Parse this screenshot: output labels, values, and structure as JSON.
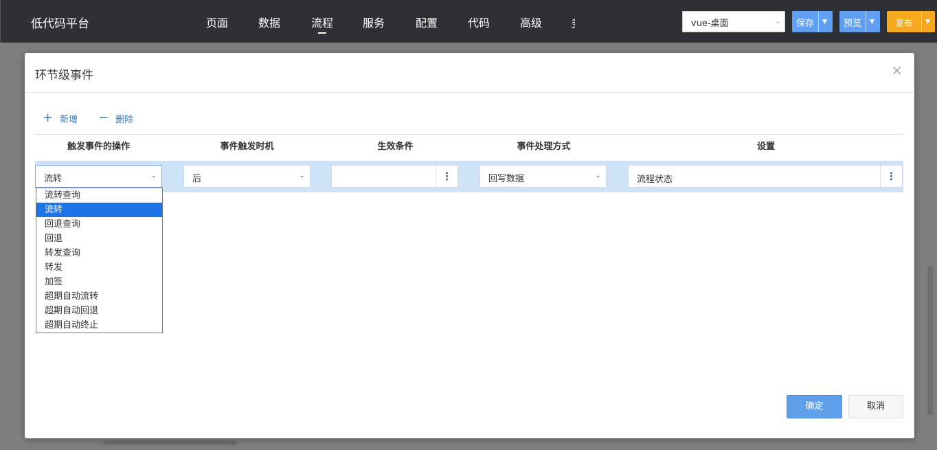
{
  "app": {
    "title": "低代码平台"
  },
  "nav": {
    "items": [
      "页面",
      "数据",
      "流程",
      "服务",
      "配置",
      "代码",
      "高级"
    ],
    "active": "流程",
    "clipped_label": "多"
  },
  "env_select": {
    "value": "vue-桌面"
  },
  "header_buttons": {
    "save": "保存",
    "preview": "预览",
    "publish": "发布"
  },
  "colors": {
    "topbar": "#2d3035",
    "primary": "#5fa0f3",
    "publish": "#f6a91c",
    "row_highlight": "#cfe3f8",
    "option_selected": "#1e73e6"
  },
  "modal": {
    "title": "环节级事件",
    "toolbar": {
      "add": "新增",
      "delete": "删除"
    },
    "columns": [
      "触发事件的操作",
      "事件触发时机",
      "生效条件",
      "事件处理方式",
      "设置"
    ],
    "row": {
      "operation": "流转",
      "timing": "后",
      "condition": "",
      "handling": "回写数据",
      "setting": "流程状态"
    },
    "dropdown": {
      "options": [
        "流转查询",
        "流转",
        "回退查询",
        "回退",
        "转发查询",
        "转发",
        "加签",
        "超期自动流转",
        "超期自动回退",
        "超期自动终止"
      ],
      "selected": "流转"
    },
    "footer": {
      "ok": "确定",
      "cancel": "取消"
    }
  }
}
